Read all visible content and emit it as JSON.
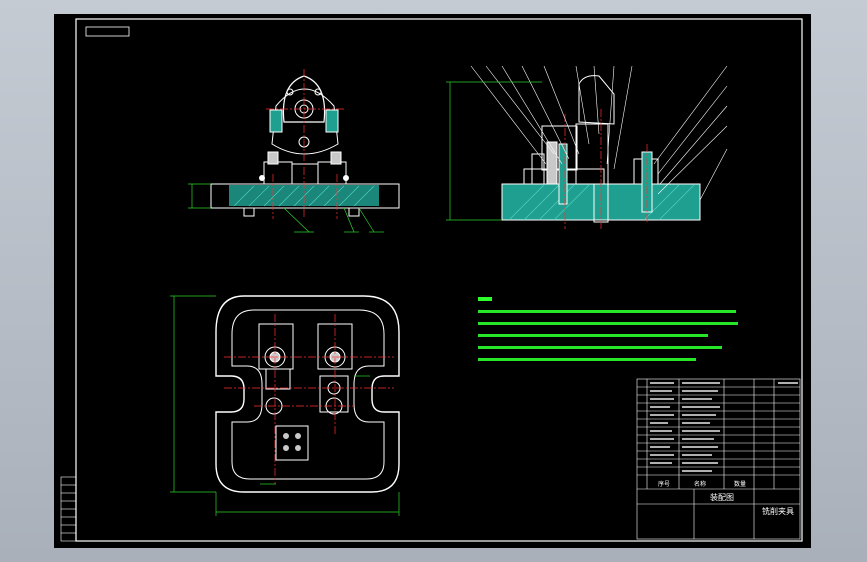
{
  "viewport": {
    "background": "#000000",
    "frame_color": "#ffffff"
  },
  "colors": {
    "outline": "#ffffff",
    "center_line": "#ff3030",
    "dimension": "#2cd32c",
    "section_fill": "#1f9f8f",
    "hatch": "#3fbfb0",
    "text": "#ffffff",
    "notes_text": "#2cff2c"
  },
  "title_block": {
    "drawing_name": "装配图",
    "part_name": "铣削夹具",
    "header_cells": [
      "序号",
      "名称",
      "数量"
    ]
  },
  "notes": {
    "heading": "技术要求"
  }
}
